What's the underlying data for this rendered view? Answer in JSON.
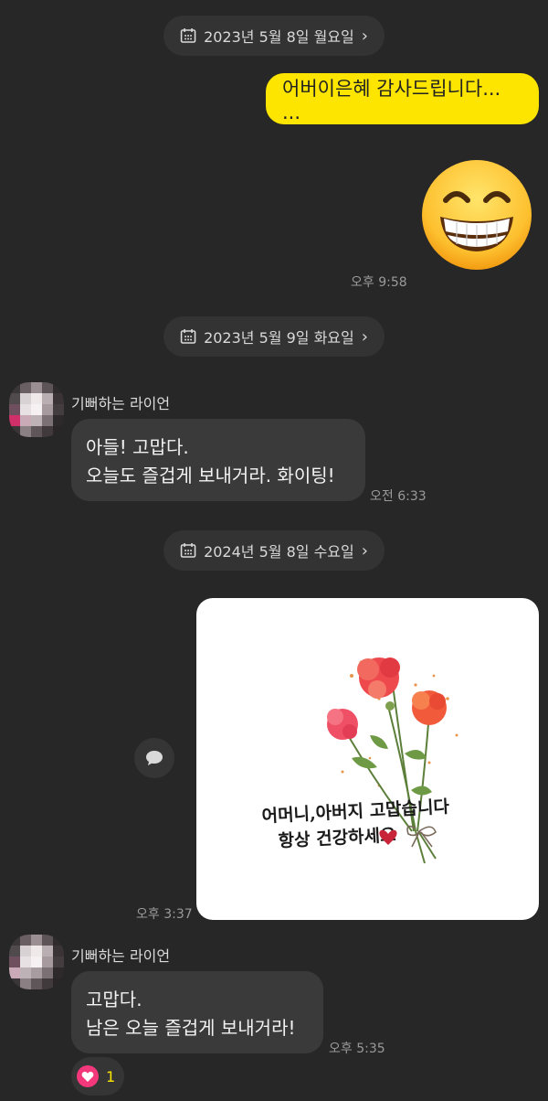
{
  "dates": [
    {
      "label": "2023년 5월 8일 월요일"
    },
    {
      "label": "2023년 5월 9일 화요일"
    },
    {
      "label": "2024년 5월 8일 수요일"
    }
  ],
  "messages": {
    "m1": {
      "text": "어버이은혜 감사드립니다... ...",
      "emoji": "grinning-face-with-smiling-eyes",
      "time": "오후 9:58"
    },
    "m2": {
      "sender": "기뻐하는 라이언",
      "line1": "아들! 고맙다.",
      "line2": "오늘도 즐겁게 보내거라. 화이팅!",
      "time": "오전 6:33"
    },
    "m3": {
      "image": "carnation-card",
      "image_text_line1": "어머니,아버지 고맙습니다",
      "image_text_line2": "항상 건강하세요",
      "time": "오후 3:37"
    },
    "m4": {
      "sender": "기뻐하는 라이언",
      "line1": "고맙다.",
      "line2": "남은 오늘 즐겁게 보내거라!",
      "time": "오후 5:35",
      "reaction_count": "1"
    }
  },
  "colors": {
    "background": "#272727",
    "my_bubble": "#fee500",
    "their_bubble": "#3a3a3a",
    "reaction_heart": "#f2387a"
  }
}
